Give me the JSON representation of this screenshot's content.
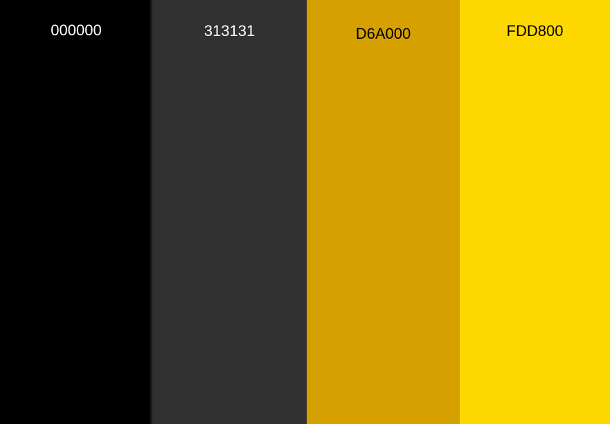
{
  "palette": {
    "swatches": [
      {
        "label": "000000",
        "color": "#000000",
        "text_color": "#ffffff"
      },
      {
        "label": "313131",
        "color": "#313131",
        "text_color": "#ffffff"
      },
      {
        "label": "D6A000",
        "color": "#D6A000",
        "text_color": "#000000"
      },
      {
        "label": "FDD800",
        "color": "#FDD800",
        "text_color": "#000000"
      }
    ]
  }
}
